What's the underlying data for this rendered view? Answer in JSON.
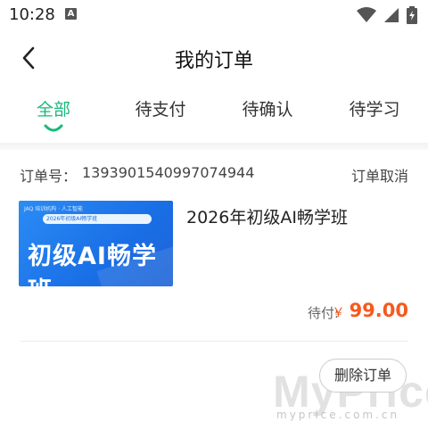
{
  "status_bar": {
    "time": "10:28",
    "notification_letter": "A",
    "icons": [
      "wifi-icon",
      "signal-icon",
      "battery-charging-icon"
    ]
  },
  "header": {
    "title": "我的订单",
    "back_icon": "chevron-left-icon"
  },
  "tabs": [
    {
      "label": "全部",
      "active": true
    },
    {
      "label": "待支付",
      "active": false
    },
    {
      "label": "待确认",
      "active": false
    },
    {
      "label": "待学习",
      "active": false
    }
  ],
  "colors": {
    "accent": "#17b978",
    "price": "#f55a1e",
    "banner_blue": "#1a6fe6"
  },
  "order": {
    "order_no_label": "订单号：",
    "order_no": "1393901540997074944",
    "cancel_label": "订单取消",
    "banner": {
      "top_text": "JAQ 培训机构 · 人工智能",
      "pill_text": "2026年初级AI畅学班",
      "main_text": "初级AI畅学班"
    },
    "course_title": "2026年初级AI畅学班",
    "pay_label": "待付:",
    "price_symbol": "￥",
    "price_value": "99.00",
    "delete_label": "删除订单"
  },
  "watermark": {
    "main": "MyPrice",
    "sub": "myprice.com.cn"
  }
}
